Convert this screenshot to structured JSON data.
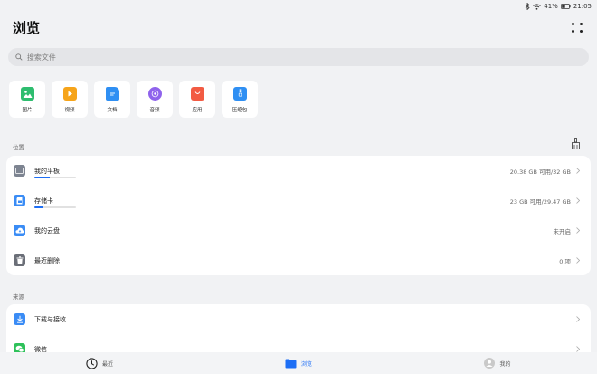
{
  "status": {
    "battery": "41%",
    "time": "21:05"
  },
  "header": {
    "title": "浏览"
  },
  "search": {
    "placeholder": "搜索文件"
  },
  "categories": [
    {
      "label": "图片",
      "icon": "image-icon",
      "color": "#2ebd6f"
    },
    {
      "label": "视频",
      "icon": "video-icon",
      "color": "#f6a41a"
    },
    {
      "label": "文档",
      "icon": "document-icon",
      "color": "#2f8ff3"
    },
    {
      "label": "音频",
      "icon": "audio-icon",
      "color": "#8f63ec"
    },
    {
      "label": "应用",
      "icon": "app-icon",
      "color": "#f25b43"
    },
    {
      "label": "压缩包",
      "icon": "archive-icon",
      "color": "#2f8ff3"
    }
  ],
  "location": {
    "label": "位置",
    "items": [
      {
        "name": "我的平板",
        "value": "20.38 GB 可用/32 GB",
        "usage": 0.36,
        "icon": "tablet-icon"
      },
      {
        "name": "存储卡",
        "value": "23 GB 可用/29.47 GB",
        "usage": 0.22,
        "icon": "sd-card-icon"
      },
      {
        "name": "我的云盘",
        "value": "未开启",
        "icon": "cloud-icon"
      },
      {
        "name": "最近删除",
        "value": "0 项",
        "icon": "trash-icon"
      }
    ]
  },
  "source": {
    "label": "来源",
    "items": [
      {
        "name": "下载与接收",
        "value": "",
        "icon": "download-icon"
      },
      {
        "name": "微信",
        "value": "",
        "icon": "wechat-icon"
      }
    ]
  },
  "nav": {
    "recent": "最近",
    "browse": "浏览",
    "mine": "我的"
  },
  "colors": {
    "accent": "#1d6ef5"
  }
}
